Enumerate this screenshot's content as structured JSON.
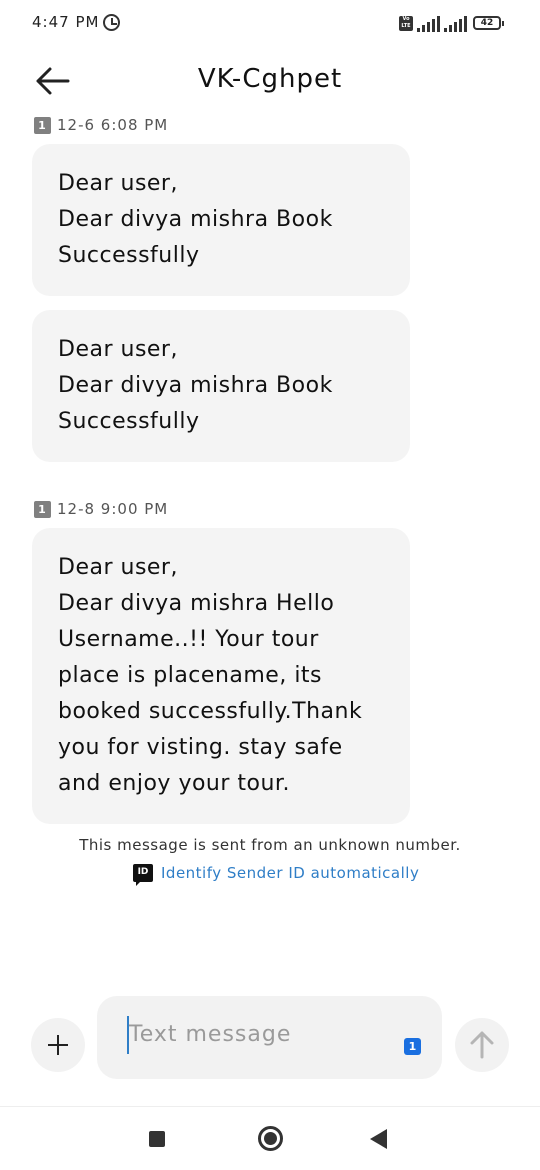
{
  "status_bar": {
    "time": "4:47 PM",
    "alarm_icon": "alarm-icon",
    "volte_label": "Vo LTE",
    "battery_level": "42"
  },
  "header": {
    "title": "VK-Cghpet",
    "back_icon": "arrow-left-icon"
  },
  "messages": [
    {
      "stamp": "12-6 6:08 PM",
      "sim": "1",
      "lines": [
        "Dear user,",
        "Dear divya mishra Book",
        "Successfully"
      ]
    },
    {
      "stamp": "",
      "sim": "",
      "lines": [
        "Dear user,",
        "Dear divya mishra Book",
        "Successfully"
      ]
    },
    {
      "stamp": "12-8 9:00 PM",
      "sim": "1",
      "lines": [
        "Dear user,",
        "Dear divya mishra Hello",
        "Username..!! Your tour",
        "place is placename, its",
        "booked successfully.Thank",
        "you for visting. stay safe",
        "and enjoy your tour."
      ]
    }
  ],
  "notice": {
    "text": "This message is sent from an unknown number.",
    "id_badge": "ID",
    "identify_link": "Identify Sender ID automatically"
  },
  "composer": {
    "placeholder": "Text message",
    "sim_chip": "1",
    "add_icon": "plus-icon",
    "send_icon": "arrow-up-icon"
  },
  "navbar": {
    "recents_icon": "square-icon",
    "home_icon": "circle-icon",
    "back_icon": "triangle-back-icon"
  }
}
